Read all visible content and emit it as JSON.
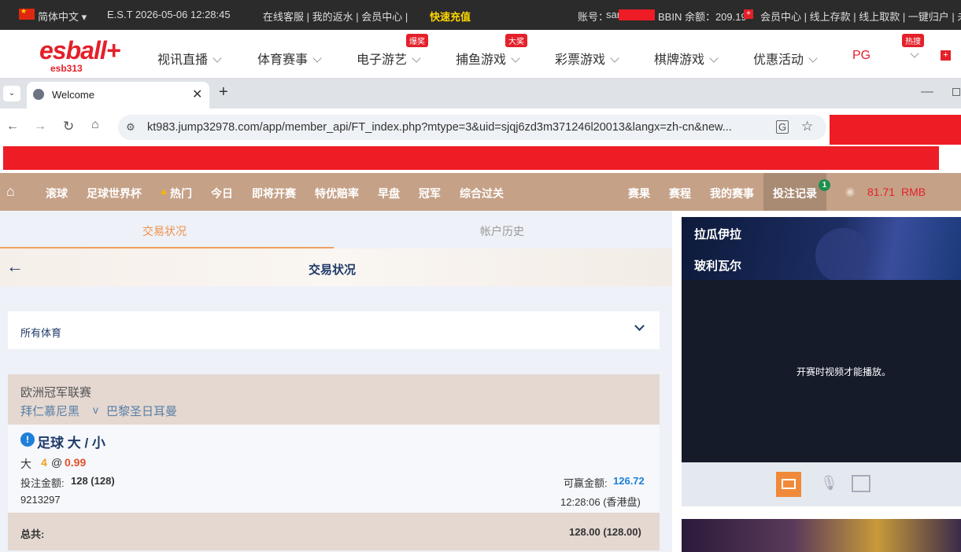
{
  "topbar": {
    "language": "简体中文",
    "clock": "E.S.T 2026-05-06 12:28:45",
    "links_left": "在线客服 | 我的返水 | 会员中心 |",
    "quick_recharge": "快速充值",
    "account_label": "账号：",
    "account_value": "sar",
    "bbin_balance": "BBIN 余额：209.19",
    "links_right": "会员中心 | 线上存款 | 线上取款 | 一键归户 | 未"
  },
  "logo": {
    "text": "esball+",
    "sub": "esb313"
  },
  "mainnav": [
    {
      "label": "视讯直播",
      "badge": ""
    },
    {
      "label": "体育赛事",
      "badge": ""
    },
    {
      "label": "电子游艺",
      "badge": "爆奖"
    },
    {
      "label": "捕鱼游戏",
      "badge": "大奖"
    },
    {
      "label": "彩票游戏",
      "badge": ""
    },
    {
      "label": "棋牌游戏",
      "badge": ""
    },
    {
      "label": "优惠活动",
      "badge": ""
    },
    {
      "label": "PG",
      "badge": ""
    },
    {
      "label": "",
      "badge": "热搜"
    }
  ],
  "browser": {
    "tab_title": "Welcome",
    "url": "kt983.jump32978.com/app/member_api/FT_index.php?mtype=3&uid=sjqj6zd3m371246l20013&langx=zh-cn&new..."
  },
  "sitenav": {
    "items": [
      "滚球",
      "足球世界杯",
      "热门",
      "今日",
      "即将开赛",
      "特优赔率",
      "早盘",
      "冠军",
      "综合过关"
    ],
    "right_items": [
      "赛果",
      "赛程",
      "我的赛事"
    ],
    "bet_record": "投注记录",
    "bet_record_badge": "1",
    "balance": "81.71",
    "currency": "RMB"
  },
  "panel": {
    "tab_active": "交易状况",
    "tab_inactive": "帐户历史",
    "header_title": "交易状况",
    "filter_label": "所有体育",
    "league": "欧洲冠军联赛",
    "home": "拜仁慕尼黑",
    "vs": "v",
    "away": "巴黎圣日耳曼",
    "bet_type": "足球 大 / 小",
    "pick": "大",
    "line": "4",
    "at": "@",
    "odds": "0.99",
    "stake_label": "投注金额:",
    "stake_value": "128 (128)",
    "win_label": "可赢金额:",
    "win_value": "126.72",
    "ticket_id": "9213297",
    "bet_time": "12:28:06 (香港盘)",
    "total_label": "总共:",
    "total_value": "128.00 (128.00)"
  },
  "video": {
    "team1": "拉瓜伊拉",
    "team2": "玻利瓦尔",
    "message": "开赛时视频才能播放。"
  }
}
